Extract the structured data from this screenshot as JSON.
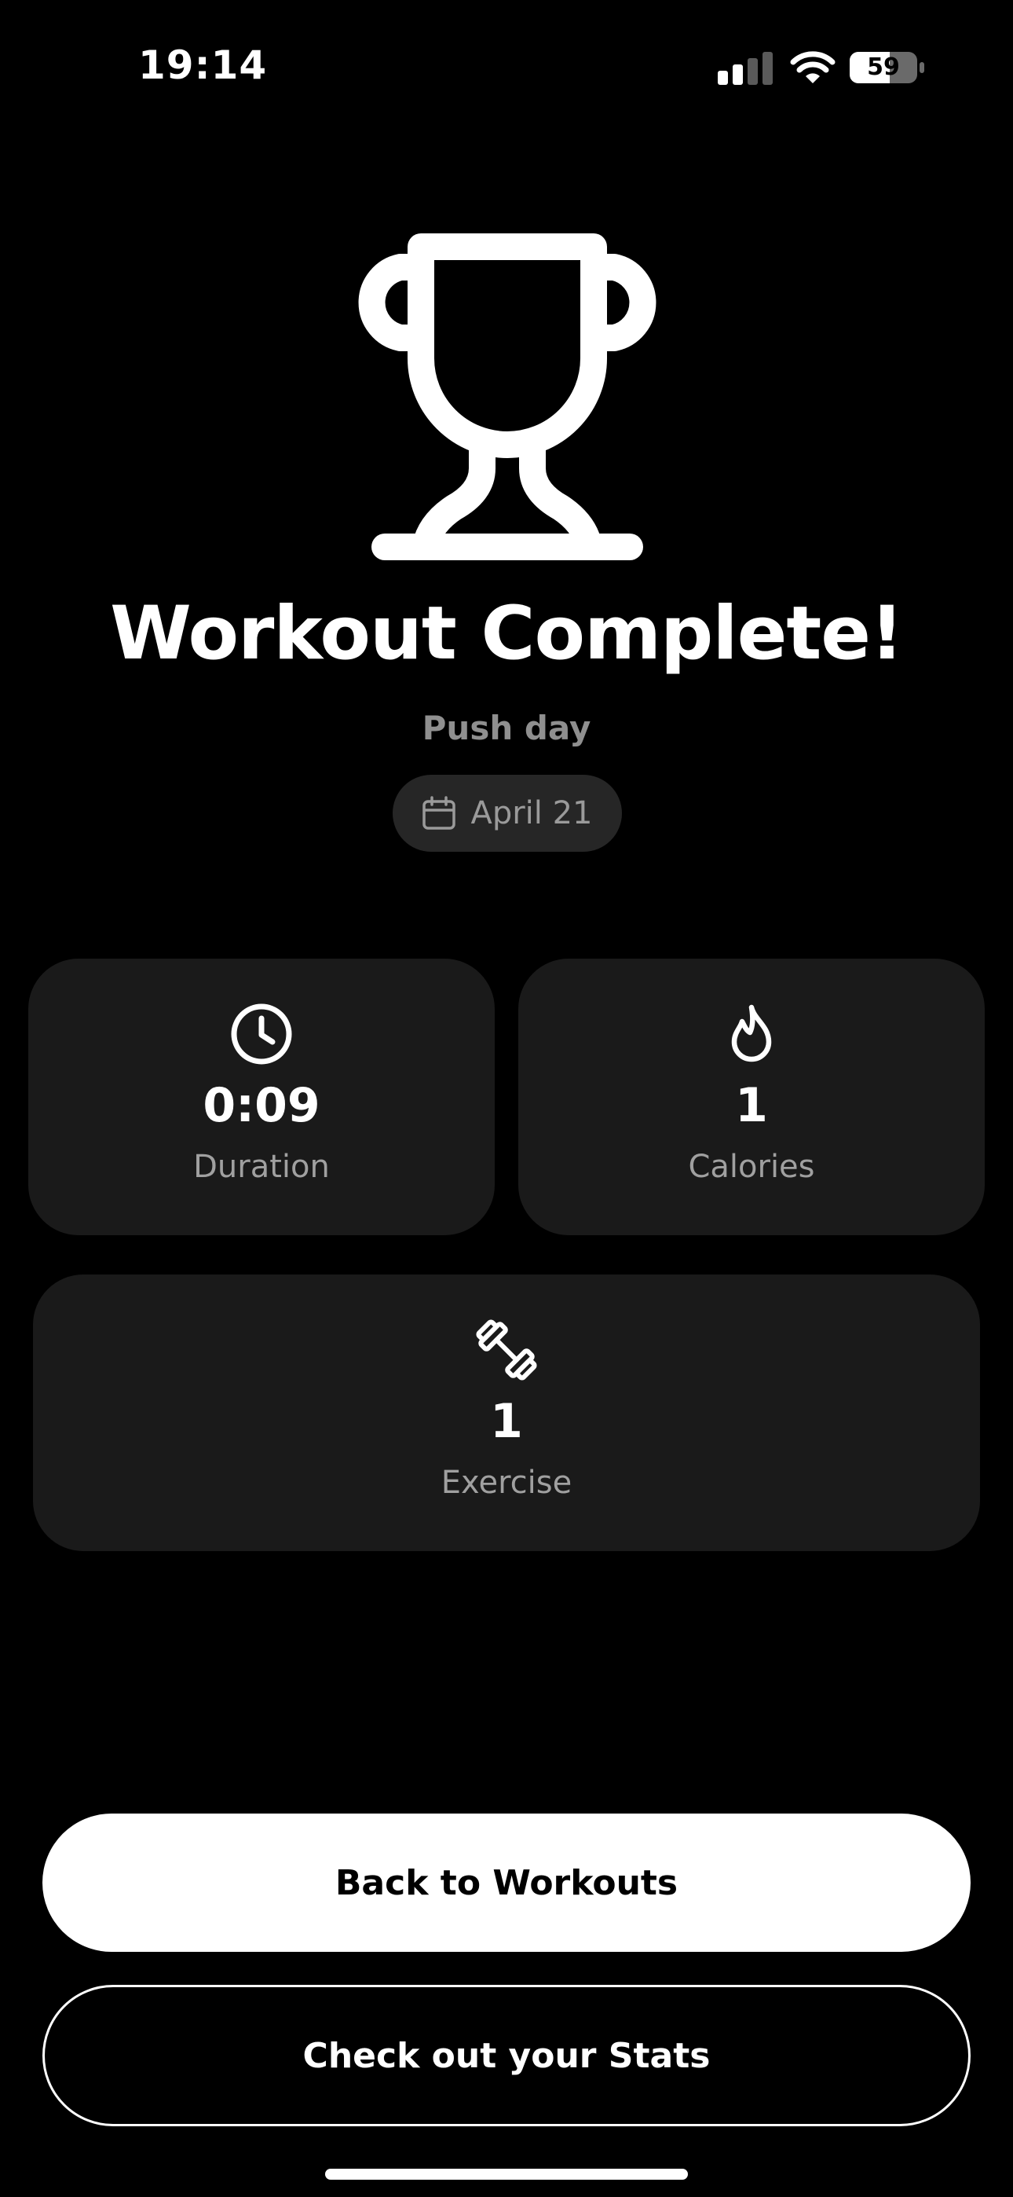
{
  "status_bar": {
    "time": "19:14",
    "battery": "59",
    "signal_icon": "cellular-signal-icon",
    "wifi_icon": "wifi-icon"
  },
  "hero": {
    "icon": "trophy-icon",
    "title": "Workout Complete!",
    "workout_name": "Push day",
    "date": "April 21",
    "date_icon": "calendar-icon"
  },
  "stats": {
    "duration": {
      "icon": "clock-icon",
      "value": "0:09",
      "label": "Duration"
    },
    "calories": {
      "icon": "flame-icon",
      "value": "1",
      "label": "Calories"
    },
    "exercise": {
      "icon": "dumbbell-icon",
      "value": "1",
      "label": "Exercise"
    }
  },
  "actions": {
    "primary_label": "Back to Workouts",
    "secondary_label": "Check out your Stats"
  },
  "colors": {
    "background": "#000000",
    "card": "#1a1a1a",
    "pill": "#262626",
    "muted_text": "#9a9a9a",
    "primary_button": "#ffffff"
  }
}
